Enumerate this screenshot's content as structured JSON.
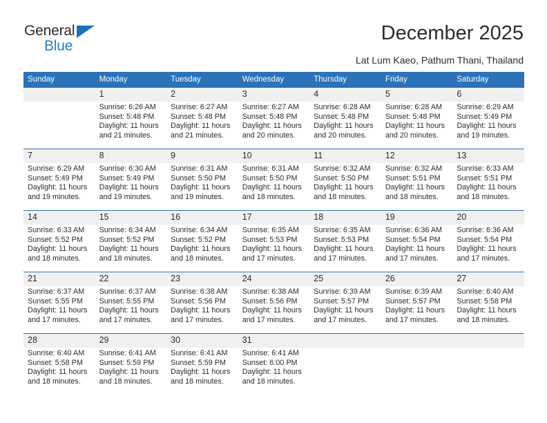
{
  "brand": {
    "name_top": "General",
    "name_bottom": "Blue",
    "color_dark": "#2b2b2b",
    "color_blue": "#1f7fd0",
    "triangle_color": "#1f6fb5"
  },
  "header": {
    "title": "December 2025",
    "subtitle": "Lat Lum Kaeo, Pathum Thani, Thailand",
    "accent_color": "#2b72b8"
  },
  "calendar": {
    "weekday_headers": [
      "Sunday",
      "Monday",
      "Tuesday",
      "Wednesday",
      "Thursday",
      "Friday",
      "Saturday"
    ],
    "header_bg": "#2b72b8",
    "header_text_color": "#ffffff",
    "daynum_bg": "#f0f0f0",
    "weeks": [
      [
        {
          "day": "",
          "sunrise": "",
          "sunset": "",
          "daylight_line1": "",
          "daylight_line2": ""
        },
        {
          "day": "1",
          "sunrise": "Sunrise: 6:26 AM",
          "sunset": "Sunset: 5:48 PM",
          "daylight_line1": "Daylight: 11 hours",
          "daylight_line2": "and 21 minutes."
        },
        {
          "day": "2",
          "sunrise": "Sunrise: 6:27 AM",
          "sunset": "Sunset: 5:48 PM",
          "daylight_line1": "Daylight: 11 hours",
          "daylight_line2": "and 21 minutes."
        },
        {
          "day": "3",
          "sunrise": "Sunrise: 6:27 AM",
          "sunset": "Sunset: 5:48 PM",
          "daylight_line1": "Daylight: 11 hours",
          "daylight_line2": "and 20 minutes."
        },
        {
          "day": "4",
          "sunrise": "Sunrise: 6:28 AM",
          "sunset": "Sunset: 5:48 PM",
          "daylight_line1": "Daylight: 11 hours",
          "daylight_line2": "and 20 minutes."
        },
        {
          "day": "5",
          "sunrise": "Sunrise: 6:28 AM",
          "sunset": "Sunset: 5:48 PM",
          "daylight_line1": "Daylight: 11 hours",
          "daylight_line2": "and 20 minutes."
        },
        {
          "day": "6",
          "sunrise": "Sunrise: 6:29 AM",
          "sunset": "Sunset: 5:49 PM",
          "daylight_line1": "Daylight: 11 hours",
          "daylight_line2": "and 19 minutes."
        }
      ],
      [
        {
          "day": "7",
          "sunrise": "Sunrise: 6:29 AM",
          "sunset": "Sunset: 5:49 PM",
          "daylight_line1": "Daylight: 11 hours",
          "daylight_line2": "and 19 minutes."
        },
        {
          "day": "8",
          "sunrise": "Sunrise: 6:30 AM",
          "sunset": "Sunset: 5:49 PM",
          "daylight_line1": "Daylight: 11 hours",
          "daylight_line2": "and 19 minutes."
        },
        {
          "day": "9",
          "sunrise": "Sunrise: 6:31 AM",
          "sunset": "Sunset: 5:50 PM",
          "daylight_line1": "Daylight: 11 hours",
          "daylight_line2": "and 19 minutes."
        },
        {
          "day": "10",
          "sunrise": "Sunrise: 6:31 AM",
          "sunset": "Sunset: 5:50 PM",
          "daylight_line1": "Daylight: 11 hours",
          "daylight_line2": "and 18 minutes."
        },
        {
          "day": "11",
          "sunrise": "Sunrise: 6:32 AM",
          "sunset": "Sunset: 5:50 PM",
          "daylight_line1": "Daylight: 11 hours",
          "daylight_line2": "and 18 minutes."
        },
        {
          "day": "12",
          "sunrise": "Sunrise: 6:32 AM",
          "sunset": "Sunset: 5:51 PM",
          "daylight_line1": "Daylight: 11 hours",
          "daylight_line2": "and 18 minutes."
        },
        {
          "day": "13",
          "sunrise": "Sunrise: 6:33 AM",
          "sunset": "Sunset: 5:51 PM",
          "daylight_line1": "Daylight: 11 hours",
          "daylight_line2": "and 18 minutes."
        }
      ],
      [
        {
          "day": "14",
          "sunrise": "Sunrise: 6:33 AM",
          "sunset": "Sunset: 5:52 PM",
          "daylight_line1": "Daylight: 11 hours",
          "daylight_line2": "and 18 minutes."
        },
        {
          "day": "15",
          "sunrise": "Sunrise: 6:34 AM",
          "sunset": "Sunset: 5:52 PM",
          "daylight_line1": "Daylight: 11 hours",
          "daylight_line2": "and 18 minutes."
        },
        {
          "day": "16",
          "sunrise": "Sunrise: 6:34 AM",
          "sunset": "Sunset: 5:52 PM",
          "daylight_line1": "Daylight: 11 hours",
          "daylight_line2": "and 18 minutes."
        },
        {
          "day": "17",
          "sunrise": "Sunrise: 6:35 AM",
          "sunset": "Sunset: 5:53 PM",
          "daylight_line1": "Daylight: 11 hours",
          "daylight_line2": "and 17 minutes."
        },
        {
          "day": "18",
          "sunrise": "Sunrise: 6:35 AM",
          "sunset": "Sunset: 5:53 PM",
          "daylight_line1": "Daylight: 11 hours",
          "daylight_line2": "and 17 minutes."
        },
        {
          "day": "19",
          "sunrise": "Sunrise: 6:36 AM",
          "sunset": "Sunset: 5:54 PM",
          "daylight_line1": "Daylight: 11 hours",
          "daylight_line2": "and 17 minutes."
        },
        {
          "day": "20",
          "sunrise": "Sunrise: 6:36 AM",
          "sunset": "Sunset: 5:54 PM",
          "daylight_line1": "Daylight: 11 hours",
          "daylight_line2": "and 17 minutes."
        }
      ],
      [
        {
          "day": "21",
          "sunrise": "Sunrise: 6:37 AM",
          "sunset": "Sunset: 5:55 PM",
          "daylight_line1": "Daylight: 11 hours",
          "daylight_line2": "and 17 minutes."
        },
        {
          "day": "22",
          "sunrise": "Sunrise: 6:37 AM",
          "sunset": "Sunset: 5:55 PM",
          "daylight_line1": "Daylight: 11 hours",
          "daylight_line2": "and 17 minutes."
        },
        {
          "day": "23",
          "sunrise": "Sunrise: 6:38 AM",
          "sunset": "Sunset: 5:56 PM",
          "daylight_line1": "Daylight: 11 hours",
          "daylight_line2": "and 17 minutes."
        },
        {
          "day": "24",
          "sunrise": "Sunrise: 6:38 AM",
          "sunset": "Sunset: 5:56 PM",
          "daylight_line1": "Daylight: 11 hours",
          "daylight_line2": "and 17 minutes."
        },
        {
          "day": "25",
          "sunrise": "Sunrise: 6:39 AM",
          "sunset": "Sunset: 5:57 PM",
          "daylight_line1": "Daylight: 11 hours",
          "daylight_line2": "and 17 minutes."
        },
        {
          "day": "26",
          "sunrise": "Sunrise: 6:39 AM",
          "sunset": "Sunset: 5:57 PM",
          "daylight_line1": "Daylight: 11 hours",
          "daylight_line2": "and 17 minutes."
        },
        {
          "day": "27",
          "sunrise": "Sunrise: 6:40 AM",
          "sunset": "Sunset: 5:58 PM",
          "daylight_line1": "Daylight: 11 hours",
          "daylight_line2": "and 18 minutes."
        }
      ],
      [
        {
          "day": "28",
          "sunrise": "Sunrise: 6:40 AM",
          "sunset": "Sunset: 5:58 PM",
          "daylight_line1": "Daylight: 11 hours",
          "daylight_line2": "and 18 minutes."
        },
        {
          "day": "29",
          "sunrise": "Sunrise: 6:41 AM",
          "sunset": "Sunset: 5:59 PM",
          "daylight_line1": "Daylight: 11 hours",
          "daylight_line2": "and 18 minutes."
        },
        {
          "day": "30",
          "sunrise": "Sunrise: 6:41 AM",
          "sunset": "Sunset: 5:59 PM",
          "daylight_line1": "Daylight: 11 hours",
          "daylight_line2": "and 18 minutes."
        },
        {
          "day": "31",
          "sunrise": "Sunrise: 6:41 AM",
          "sunset": "Sunset: 6:00 PM",
          "daylight_line1": "Daylight: 11 hours",
          "daylight_line2": "and 18 minutes."
        },
        {
          "day": "",
          "sunrise": "",
          "sunset": "",
          "daylight_line1": "",
          "daylight_line2": ""
        },
        {
          "day": "",
          "sunrise": "",
          "sunset": "",
          "daylight_line1": "",
          "daylight_line2": ""
        },
        {
          "day": "",
          "sunrise": "",
          "sunset": "",
          "daylight_line1": "",
          "daylight_line2": ""
        }
      ]
    ]
  }
}
